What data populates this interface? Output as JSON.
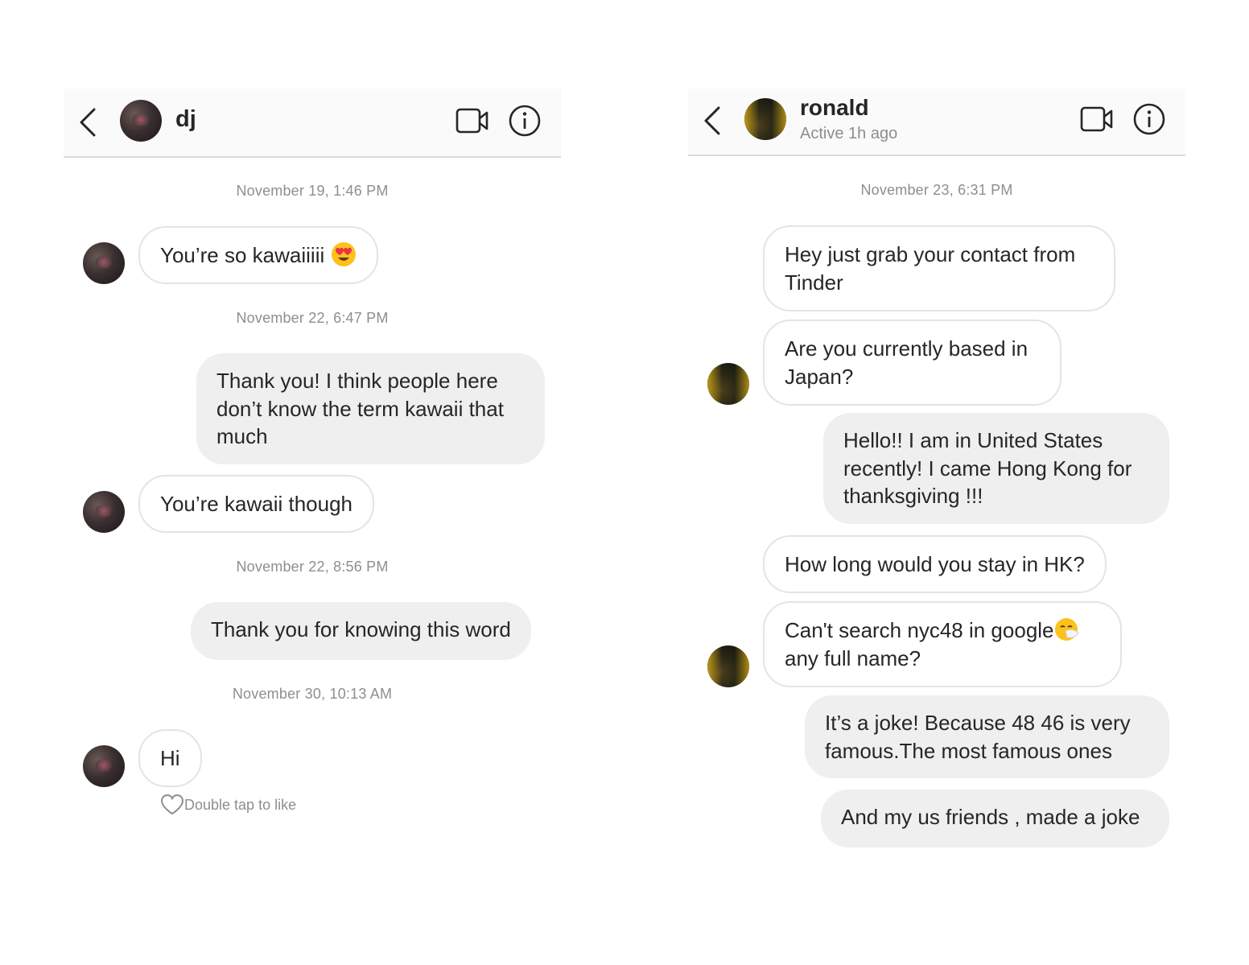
{
  "left": {
    "header": {
      "name": "dj"
    },
    "timestamps": [
      "November 19, 1:46 PM",
      "November 22, 6:47 PM",
      "November 22, 8:56 PM",
      "November 30, 10:13 AM"
    ],
    "messages": [
      {
        "text": "You’re so kawaiiiii",
        "emoji": "heart-eyes-emoji"
      },
      {
        "text": "Thank you! I think people here don’t know the term kawaii that much"
      },
      {
        "text": "You’re kawaii though"
      },
      {
        "text": "Thank you for knowing this word"
      },
      {
        "text": "Hi"
      }
    ],
    "like_hint": "Double tap to like"
  },
  "right": {
    "header": {
      "name": "ronald",
      "status": "Active 1h ago"
    },
    "timestamps": [
      "November 23, 6:31 PM"
    ],
    "messages": [
      {
        "text": "Hey just grab your contact from Tinder"
      },
      {
        "text": "Are you currently based in Japan?"
      },
      {
        "text": "Hello!! I am in United States recently! I came Hong Kong for thanksgiving !!!"
      },
      {
        "text": "How long would you stay in HK?"
      },
      {
        "text": "Can't search nyc48 in google",
        "text2": "any full name?",
        "emoji": "sneezing-face-emoji"
      },
      {
        "text": "It’s a joke! Because 48 46 is very famous.The most famous ones"
      },
      {
        "text": "And my us friends , made a joke"
      }
    ]
  },
  "icons": [
    "back-chevron-icon",
    "video-call-icon",
    "info-icon",
    "heart-outline-icon"
  ],
  "colors": {
    "incoming_border": "#e4e4e4",
    "outgoing_bg": "#efefef",
    "timestamp": "#8e8e8e",
    "header_bg": "#fafafa"
  }
}
